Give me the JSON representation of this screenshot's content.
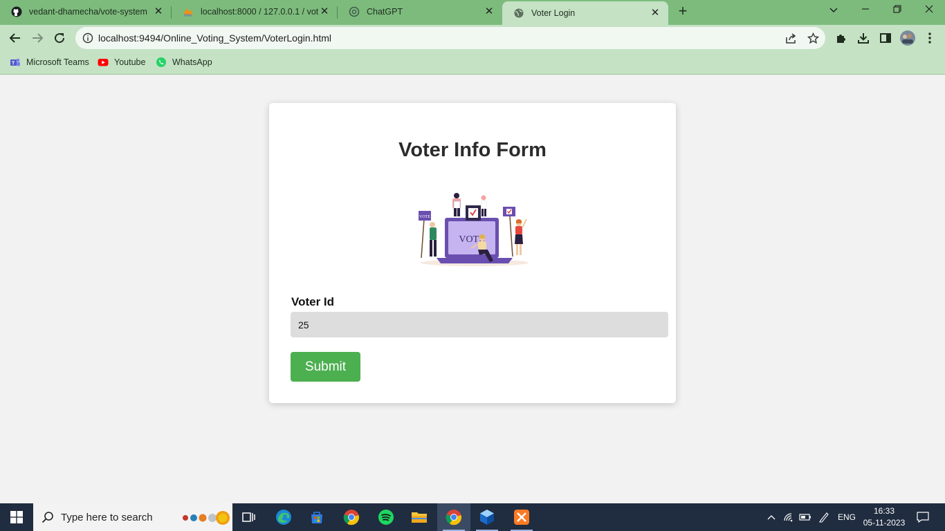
{
  "browser": {
    "tabs": [
      {
        "title": "vedant-dhamecha/vote-system",
        "icon": "github-icon"
      },
      {
        "title": "localhost:8000 / 127.0.0.1 / vote",
        "icon": "phpmyadmin-icon"
      },
      {
        "title": "ChatGPT",
        "icon": "chatgpt-icon"
      },
      {
        "title": "Voter Login",
        "icon": "globe-icon",
        "active": true
      }
    ],
    "url": "localhost:9494/Online_Voting_System/VoterLogin.html",
    "bookmarks": [
      {
        "label": "Microsoft Teams",
        "icon": "teams-icon"
      },
      {
        "label": "Youtube",
        "icon": "youtube-icon"
      },
      {
        "label": "WhatsApp",
        "icon": "whatsapp-icon"
      }
    ],
    "accent_color": "#7dbb7d"
  },
  "page": {
    "title": "Voter Info Form",
    "illustration_text": "VOTE",
    "sign_text": "VOTE",
    "form": {
      "voter_id_label": "Voter Id",
      "voter_id_value": "25",
      "submit_label": "Submit"
    },
    "submit_color": "#4caf50"
  },
  "taskbar": {
    "search_placeholder": "Type here to search",
    "language": "ENG",
    "time": "16:33",
    "date": "05-11-2023"
  }
}
